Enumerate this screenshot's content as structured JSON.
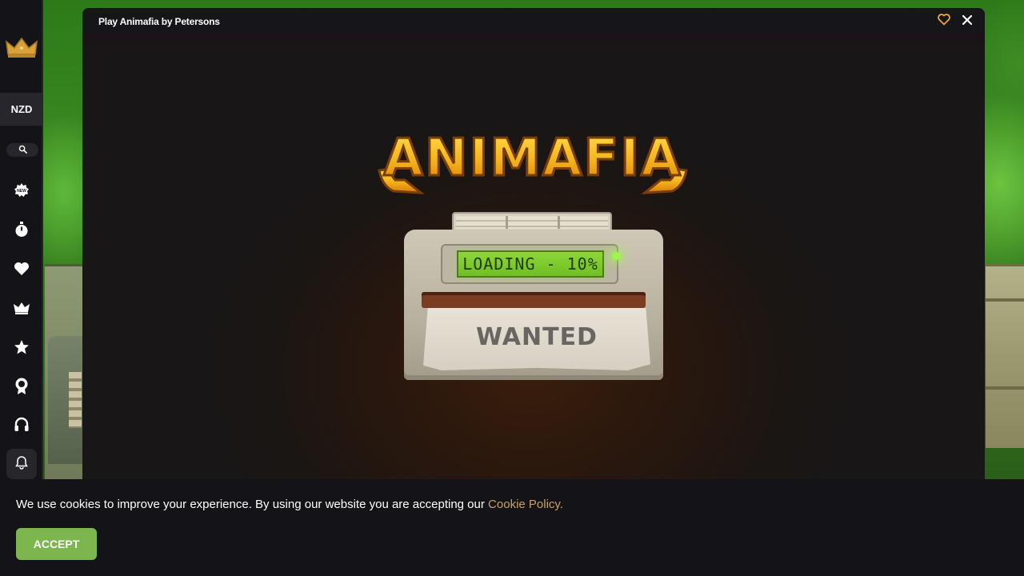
{
  "sidebar": {
    "logo_icon": "crown-logo-icon",
    "currency": "NZD",
    "search_icon": "search-icon",
    "items": [
      {
        "icon": "new-badge-icon"
      },
      {
        "icon": "stopwatch-icon"
      },
      {
        "icon": "heart-icon"
      },
      {
        "icon": "crown-icon"
      },
      {
        "icon": "star-icon"
      },
      {
        "icon": "medal-icon"
      },
      {
        "icon": "headset-icon"
      }
    ],
    "bell_icon": "bell-icon"
  },
  "game_modal": {
    "title": "Play Animafia by Petersons",
    "favorite_icon": "heart-outline-icon",
    "close_icon": "close-icon",
    "game": {
      "logo_text": "ANIMAFIA",
      "loading_text": "LOADING - 10%",
      "loading_progress_percent": 10,
      "wanted_text": "WANTED"
    }
  },
  "cookie_banner": {
    "message": "We use cookies to improve your experience. By using our website you are accepting our",
    "link_text": "Cookie Policy.",
    "accept_label": "ACCEPT"
  },
  "colors": {
    "accent_gold": "#e8a93c",
    "accept_green": "#7db54f",
    "link_tan": "#c9a06a",
    "lcd_green": "#8ed53a"
  }
}
